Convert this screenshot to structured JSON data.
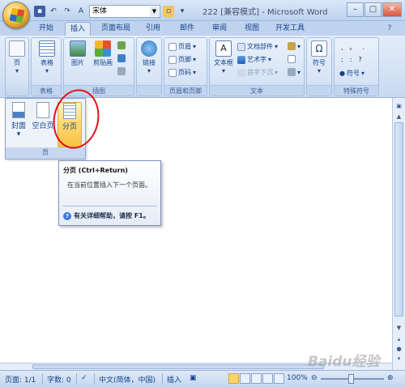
{
  "window": {
    "title": "222 [兼容模式] - Microsoft Word",
    "font_name": "宋体"
  },
  "tabs": [
    "开始",
    "插入",
    "页面布局",
    "引用",
    "邮件",
    "审阅",
    "视图",
    "开发工具"
  ],
  "active_tab": "插入",
  "ribbon": {
    "groups": {
      "pages": {
        "label": "页",
        "button": "页"
      },
      "table": {
        "label": "表格",
        "button": "表格"
      },
      "illustrations": {
        "label": "插图",
        "picture": "图片",
        "clipart": "剪贴画"
      },
      "links": {
        "label": "",
        "button": "链接"
      },
      "header_footer": {
        "label": "页眉和页脚",
        "header": "页眉",
        "footer": "页脚",
        "page_number": "页码"
      },
      "text": {
        "label": "文本",
        "textbox": "文本框",
        "quick_parts": "文档部件",
        "wordart": "艺术字",
        "dropcap": "首字下沉"
      },
      "symbols": {
        "label": "特殊符号",
        "symbol": "符号",
        "symbol_dd": "符号"
      }
    }
  },
  "pages_dropdown": {
    "label": "页",
    "buttons": [
      "封面",
      "空白页",
      "分页"
    ]
  },
  "tooltip": {
    "title": "分页 (Ctrl+Return)",
    "description": "在当前位置插入下一个页面。",
    "help": "有关详细帮助，请按 F1。"
  },
  "status": {
    "page": "页面: 1/1",
    "words": "字数: 0",
    "language": "中文(简体，中国)",
    "mode": "插入",
    "zoom": "100%"
  },
  "watermark": "Baidu经验",
  "colors": {
    "accent": "#15428b",
    "highlight": "#ffd769",
    "annotation": "#e0121c"
  }
}
